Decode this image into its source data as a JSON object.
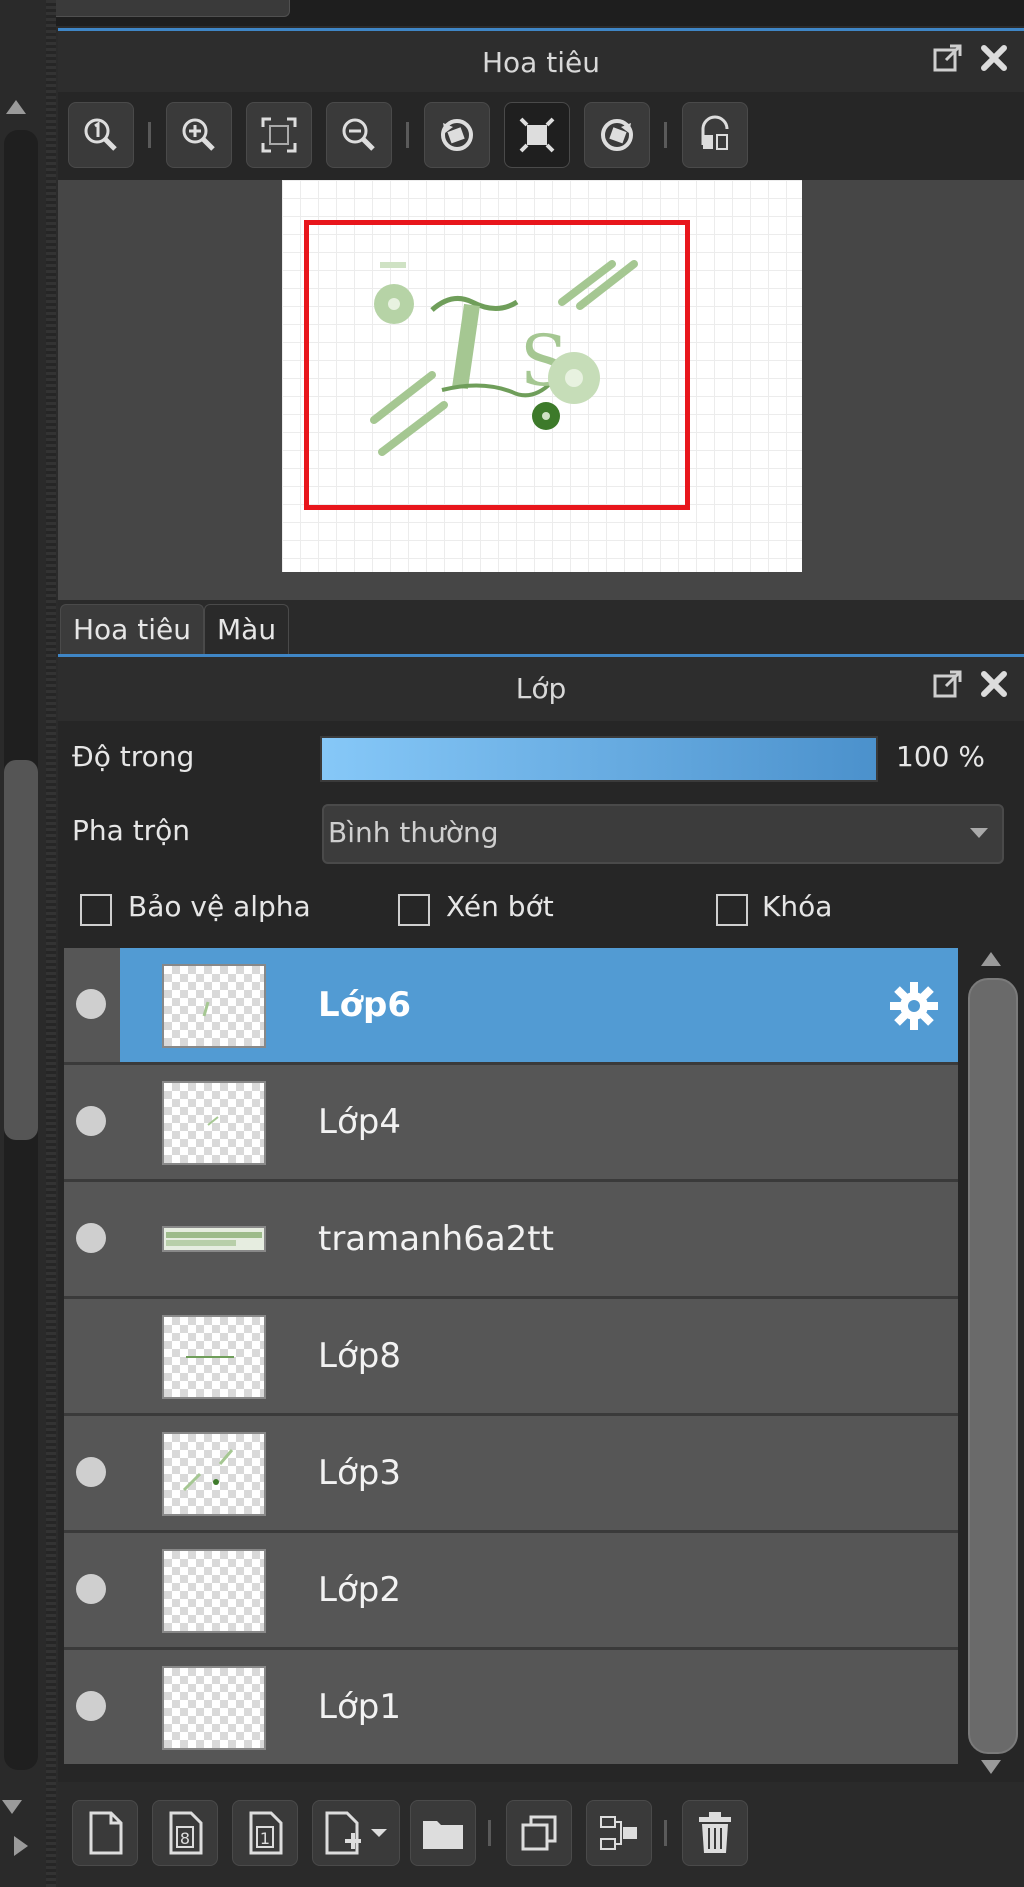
{
  "navigator_panel": {
    "title": "Hoa tiêu",
    "tabs": [
      "Hoa tiêu",
      "Màu"
    ],
    "active_tab": "Hoa tiêu",
    "toolbar_icons": [
      "zoom-actual-icon",
      "zoom-in-icon",
      "fit-icon",
      "zoom-out-icon",
      "rotate-left-icon",
      "fit-window-icon",
      "rotate-right-icon",
      "flip-icon"
    ]
  },
  "layer_panel": {
    "title": "Lớp",
    "opacity_label": "Độ trong",
    "opacity_value": "100 %",
    "opacity_fraction": 1.0,
    "blend_label": "Pha trộn",
    "blend_value": "Bình thường",
    "checkboxes": {
      "alpha_protect": {
        "label": "Bảo vệ alpha",
        "checked": false
      },
      "clipping": {
        "label": "Xén bớt",
        "checked": false
      },
      "lock": {
        "label": "Khóa",
        "checked": false
      }
    },
    "layers": [
      {
        "name": "Lớp6",
        "selected": true,
        "visible": true
      },
      {
        "name": "Lớp4",
        "selected": false,
        "visible": true
      },
      {
        "name": "tramanh6a2tt",
        "selected": false,
        "visible": true
      },
      {
        "name": "Lớp8",
        "selected": false,
        "visible": false
      },
      {
        "name": "Lớp3",
        "selected": false,
        "visible": true
      },
      {
        "name": "Lớp2",
        "selected": false,
        "visible": true
      },
      {
        "name": "Lớp1",
        "selected": false,
        "visible": true
      }
    ],
    "bottom_icons": [
      "new-layer-icon",
      "new-8bit-layer-icon",
      "new-1bit-layer-icon",
      "add-layer-menu-icon",
      "new-folder-icon",
      "duplicate-layer-icon",
      "merge-down-icon",
      "delete-layer-icon"
    ]
  },
  "colors": {
    "accent": "#529bd3",
    "viewport": "#e8161c",
    "panel_border": "#3f86c6"
  }
}
